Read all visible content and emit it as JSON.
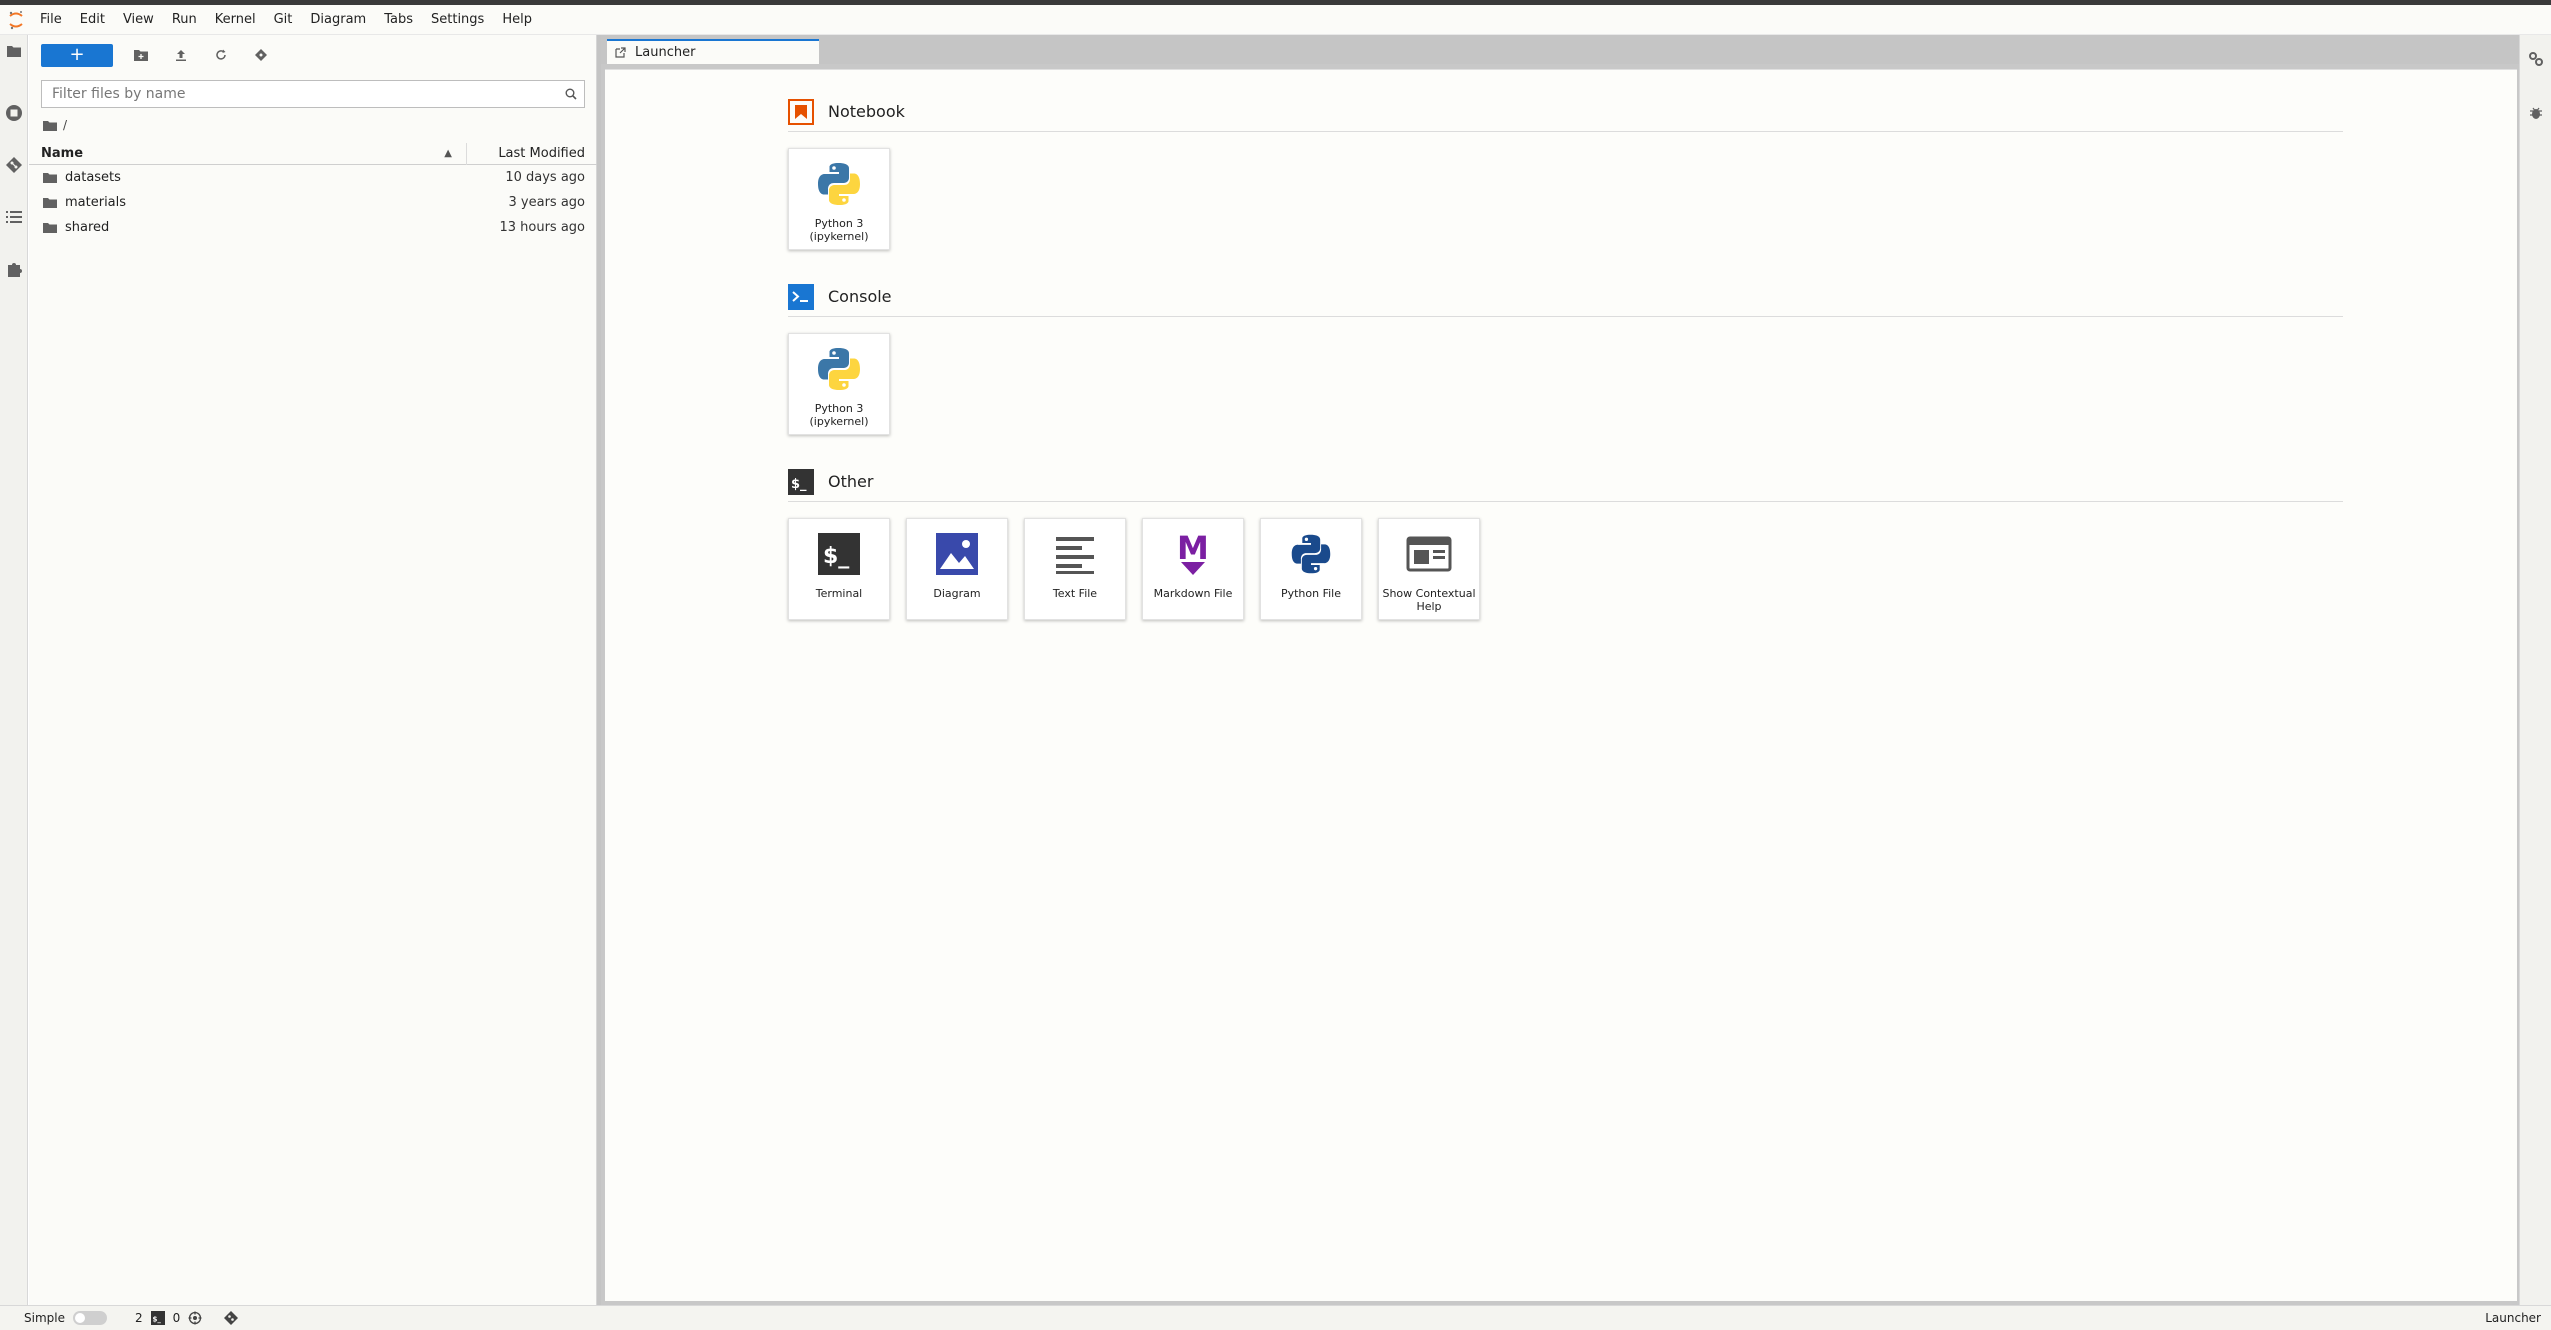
{
  "menubar": {
    "items": [
      "File",
      "Edit",
      "View",
      "Run",
      "Kernel",
      "Git",
      "Diagram",
      "Tabs",
      "Settings",
      "Help"
    ]
  },
  "filebrowser": {
    "new_label": "+",
    "filter_placeholder": "Filter files by name",
    "breadcrumb": "/",
    "columns": {
      "name": "Name",
      "modified": "Last Modified"
    },
    "rows": [
      {
        "name": "datasets",
        "modified": "10 days ago"
      },
      {
        "name": "materials",
        "modified": "3 years ago"
      },
      {
        "name": "shared",
        "modified": "13 hours ago"
      }
    ]
  },
  "tabs": [
    {
      "label": "Launcher"
    }
  ],
  "launcher": {
    "sections": [
      {
        "title": "Notebook",
        "icon": "notebook-icon",
        "cards": [
          {
            "label": "Python 3 (ipykernel)",
            "icon": "python-icon"
          }
        ]
      },
      {
        "title": "Console",
        "icon": "console-icon",
        "cards": [
          {
            "label": "Python 3 (ipykernel)",
            "icon": "python-icon"
          }
        ]
      },
      {
        "title": "Other",
        "icon": "terminal-icon",
        "cards": [
          {
            "label": "Terminal",
            "icon": "terminal-icon"
          },
          {
            "label": "Diagram",
            "icon": "diagram-icon"
          },
          {
            "label": "Text File",
            "icon": "text-file-icon"
          },
          {
            "label": "Markdown File",
            "icon": "markdown-icon"
          },
          {
            "label": "Python File",
            "icon": "python-file-icon"
          },
          {
            "label": "Show Contextual Help",
            "icon": "contextual-help-icon"
          }
        ]
      }
    ]
  },
  "statusbar": {
    "mode_label": "Simple",
    "terminals_count": "2",
    "kernels_count": "0",
    "current_activity": "Launcher"
  },
  "colors": {
    "accent": "#1976d2",
    "notebook": "#e65100",
    "console": "#1976d2",
    "markdown": "#7b1fa2",
    "diagram": "#3949ab"
  }
}
